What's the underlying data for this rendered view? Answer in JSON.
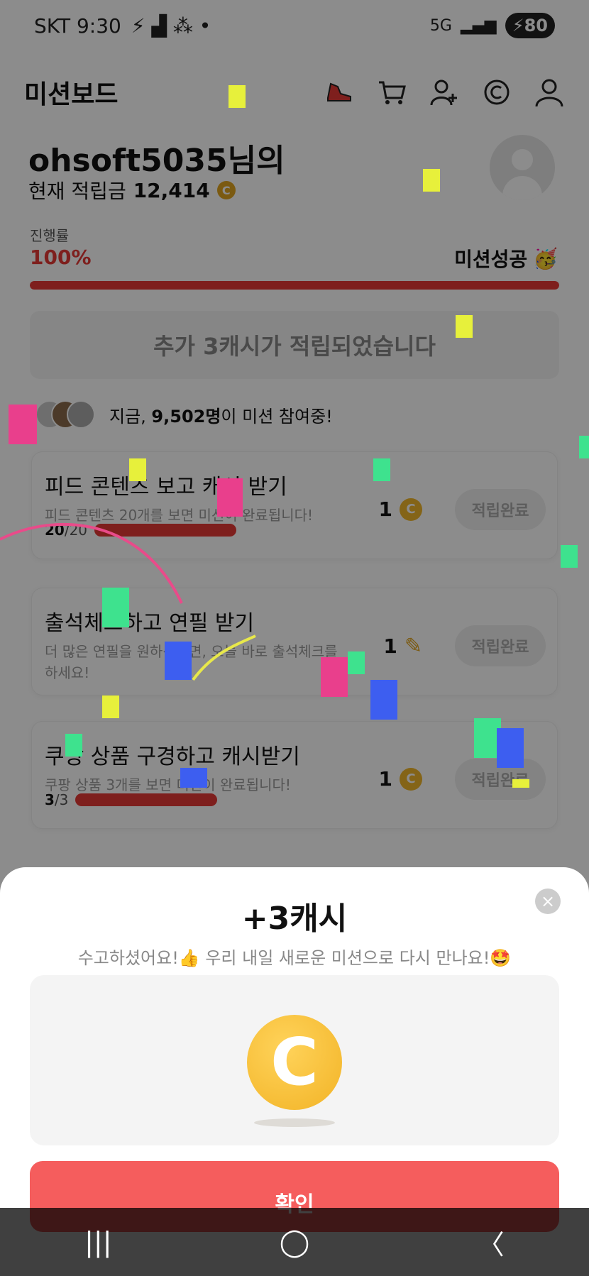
{
  "status_bar": {
    "carrier_time": "SKT 9:30",
    "network": "5G",
    "battery": "80"
  },
  "header": {
    "title": "미션보드"
  },
  "profile": {
    "greeting": "ohsoft5035님의",
    "balance_label": "현재 적립금",
    "balance_value": "12,414",
    "coin_symbol": "C"
  },
  "progress": {
    "label": "진행률",
    "value": "100%",
    "fraction": 1.0,
    "success_text": "미션성공",
    "success_emoji": "🥳"
  },
  "banner": {
    "text": "추가 3캐시가 적립되었습니다"
  },
  "participants": {
    "prefix": "지금, ",
    "count": "9,502명",
    "suffix": "이 미션 참여중!"
  },
  "missions": [
    {
      "title": "피드 콘텐츠 보고 캐시 받기",
      "desc": "피드 콘텐츠 20개를 보면 미션이 완료됩니다!",
      "count_done": "20",
      "count_total": "/20",
      "reward": "1",
      "reward_icon": "coin-icon",
      "button": "적립완료"
    },
    {
      "title": "출석체크하고 연필 받기",
      "desc": "더 많은 연필을 원하신다면, 오늘 바로 출석체크를 하세요!",
      "reward": "1",
      "reward_icon": "pencil-icon",
      "button": "적립완료"
    },
    {
      "title": "쿠팡 상품 구경하고 캐시받기",
      "desc": "쿠팡 상품 3개를 보면 미션이 완료됩니다!",
      "count_done": "3",
      "count_total": "/3",
      "reward": "1",
      "reward_icon": "coin-icon",
      "button": "적립완료"
    }
  ],
  "sheet": {
    "title": "+3캐시",
    "subtitle": "수고하셨어요!👍 우리 내일 새로운 미션으로 다시 만나요!🤩",
    "confirm": "확인",
    "close": "×",
    "coin_glyph": "C"
  },
  "navbar": {
    "recent": "|||",
    "home": "◯",
    "back": "〈"
  },
  "colors": {
    "accent": "#e53935",
    "confirm": "#f55d5d",
    "coin": "#f1b62a"
  }
}
